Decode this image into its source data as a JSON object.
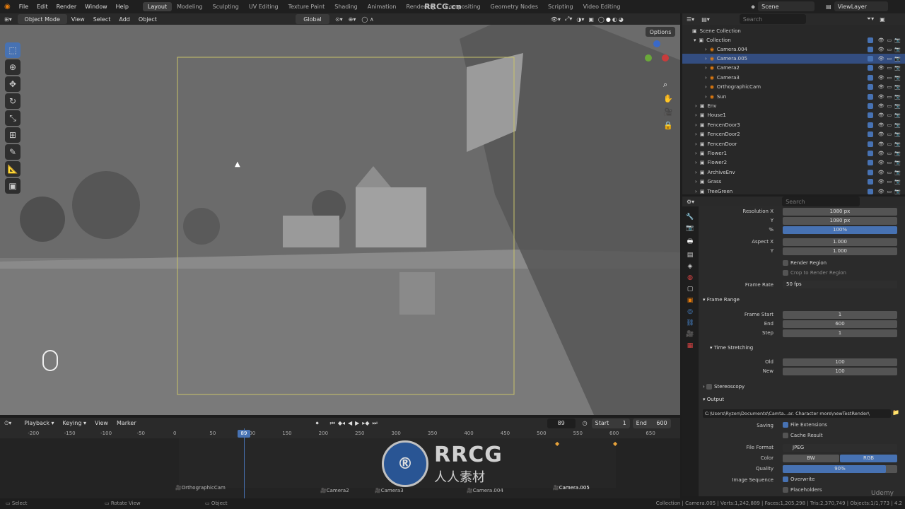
{
  "topbar": {
    "menus": [
      "File",
      "Edit",
      "Render",
      "Window",
      "Help"
    ],
    "workspaces": [
      "Layout",
      "Modeling",
      "Sculpting",
      "UV Editing",
      "Texture Paint",
      "Shading",
      "Animation",
      "Rendering",
      "Compositing",
      "Geometry Nodes",
      "Scripting",
      "Video Editing"
    ],
    "active_workspace": "Layout",
    "scene": "Scene",
    "view_layer": "ViewLayer"
  },
  "viewport_header": {
    "mode": "Object Mode",
    "menus": [
      "View",
      "Select",
      "Add",
      "Object"
    ],
    "orientation": "Global",
    "options": "Options"
  },
  "outliner": {
    "search_placeholder": "Search",
    "scene_collection": "Scene Collection",
    "collection": "Collection",
    "items": [
      {
        "name": "Camera.004",
        "depth": 2,
        "selected": false
      },
      {
        "name": "Camera.005",
        "depth": 2,
        "selected": true
      },
      {
        "name": "Camera2",
        "depth": 2,
        "selected": false
      },
      {
        "name": "Camera3",
        "depth": 2,
        "selected": false
      },
      {
        "name": "OrthographicCam",
        "depth": 2,
        "selected": false
      },
      {
        "name": "Sun",
        "depth": 2,
        "selected": false
      },
      {
        "name": "Env",
        "depth": 1,
        "selected": false
      },
      {
        "name": "House1",
        "depth": 1,
        "selected": false
      },
      {
        "name": "FencenDoor3",
        "depth": 1,
        "selected": false
      },
      {
        "name": "FencenDoor2",
        "depth": 1,
        "selected": false
      },
      {
        "name": "FencenDoor",
        "depth": 1,
        "selected": false
      },
      {
        "name": "Flower1",
        "depth": 1,
        "selected": false
      },
      {
        "name": "Flower2",
        "depth": 1,
        "selected": false
      },
      {
        "name": "ArchiveEnv",
        "depth": 1,
        "selected": false
      },
      {
        "name": "Grass",
        "depth": 1,
        "selected": false
      },
      {
        "name": "TreeGreen",
        "depth": 1,
        "selected": false
      }
    ]
  },
  "properties": {
    "search_placeholder": "Search",
    "resolution_x_label": "Resolution X",
    "resolution_x": "1080 px",
    "y_label": "Y",
    "resolution_y": "1080 px",
    "percent_label": "%",
    "percent": "100%",
    "aspect_x_label": "Aspect X",
    "aspect_x": "1.000",
    "aspect_y": "1.000",
    "render_region": "Render Region",
    "crop_region": "Crop to Render Region",
    "frame_rate_label": "Frame Rate",
    "frame_rate": "50 fps",
    "frame_range_title": "Frame Range",
    "frame_start_label": "Frame Start",
    "frame_start": "1",
    "end_label": "End",
    "frame_end": "600",
    "step_label": "Step",
    "step": "1",
    "time_stretching": "Time Stretching",
    "old_label": "Old",
    "old": "100",
    "new_label": "New",
    "new": "100",
    "stereoscopy": "Stereoscopy",
    "output_title": "Output",
    "output_path": "C:\\Users\\Ryzen\\Documents\\Camta...ar. Character more\\newTestRender\\",
    "saving_label": "Saving",
    "file_extensions": "File Extensions",
    "cache_result": "Cache Result",
    "file_format_label": "File Format",
    "file_format": "JPEG",
    "color_label": "Color",
    "color_bw": "BW",
    "color_rgb": "RGB",
    "quality_label": "Quality",
    "quality": "90%",
    "image_sequence_label": "Image Sequence",
    "overwrite": "Overwrite",
    "placeholders": "Placeholders"
  },
  "timeline": {
    "menus": [
      "Playback",
      "Keying",
      "View",
      "Marker"
    ],
    "current_frame": "89",
    "start_label": "Start",
    "start": "1",
    "end_label": "End",
    "end": "600",
    "ruler": [
      "-200",
      "-150",
      "-100",
      "-50",
      "0",
      "50",
      "100",
      "150",
      "200",
      "250",
      "300",
      "350",
      "400",
      "450",
      "500",
      "550",
      "600",
      "650"
    ],
    "playhead": "89",
    "markers": [
      "OrthographicCam",
      "Camera2",
      "Camera3",
      "Camera.004",
      "Camera.005"
    ]
  },
  "statusbar": {
    "select": "Select",
    "rotate": "Rotate View",
    "object": "Object",
    "info": "Collection | Camera.005 | Verts:1,242,889 | Faces:1,205,298 | Tris:2,370,749 | Objects:1/1,773 | 4.2"
  },
  "watermark": {
    "brand": "RRCG",
    "site": "RRCG.cn",
    "cn": "人人素材",
    "udemy": "Udemy"
  }
}
